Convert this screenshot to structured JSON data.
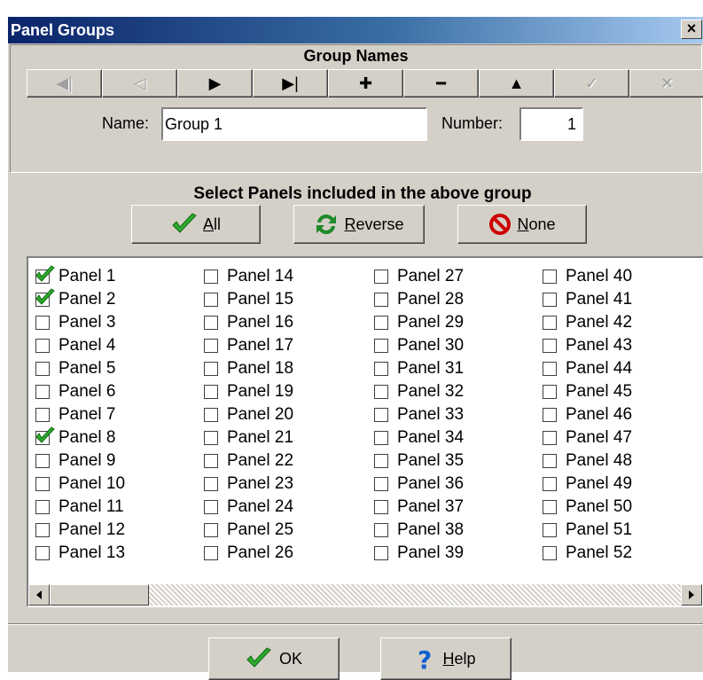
{
  "window": {
    "title": "Panel Groups",
    "close_label": "×"
  },
  "group_names": {
    "heading": "Group Names",
    "nav_buttons": [
      {
        "name": "first-record",
        "glyph": "◀|",
        "enabled": false
      },
      {
        "name": "prior-record",
        "glyph": "◁",
        "enabled": false
      },
      {
        "name": "next-record",
        "glyph": "▶",
        "enabled": true
      },
      {
        "name": "last-record",
        "glyph": "▶|",
        "enabled": true
      },
      {
        "name": "insert-record",
        "glyph": "✚",
        "enabled": true
      },
      {
        "name": "delete-record",
        "glyph": "━",
        "enabled": true
      },
      {
        "name": "edit-record",
        "glyph": "▲",
        "enabled": true
      },
      {
        "name": "post-edit",
        "glyph": "✓",
        "enabled": false
      },
      {
        "name": "cancel-edit",
        "glyph": "✕",
        "enabled": false
      }
    ]
  },
  "fields": {
    "name_label": "Name:",
    "name_value": "Group 1",
    "number_label": "Number:",
    "number_value": "1"
  },
  "selection": {
    "heading": "Select Panels included in the above group",
    "all_prefix": "",
    "all_key": "A",
    "all_rest": "ll",
    "reverse_key": "R",
    "reverse_rest": "everse",
    "none_key": "N",
    "none_rest": "one"
  },
  "panels": {
    "columns": [
      [
        "Panel 1",
        "Panel 2",
        "Panel 3",
        "Panel 4",
        "Panel 5",
        "Panel 6",
        "Panel 7",
        "Panel 8",
        "Panel 9",
        "Panel 10",
        "Panel 11",
        "Panel 12",
        "Panel 13"
      ],
      [
        "Panel 14",
        "Panel 15",
        "Panel 16",
        "Panel 17",
        "Panel 18",
        "Panel 19",
        "Panel 20",
        "Panel 21",
        "Panel 22",
        "Panel 23",
        "Panel 24",
        "Panel 25",
        "Panel 26"
      ],
      [
        "Panel 27",
        "Panel 28",
        "Panel 29",
        "Panel 30",
        "Panel 31",
        "Panel 32",
        "Panel 33",
        "Panel 34",
        "Panel 35",
        "Panel 36",
        "Panel 37",
        "Panel 38",
        "Panel 39"
      ],
      [
        "Panel 40",
        "Panel 41",
        "Panel 42",
        "Panel 43",
        "Panel 44",
        "Panel 45",
        "Panel 46",
        "Panel 47",
        "Panel 48",
        "Panel 49",
        "Panel 50",
        "Panel 51",
        "Panel 52"
      ]
    ],
    "checked": [
      "Panel 1",
      "Panel 2",
      "Panel 8"
    ]
  },
  "footer": {
    "ok_label": "OK",
    "help_key": "H",
    "help_rest": "elp"
  },
  "colors": {
    "check_green": "#2eaa2e",
    "reverse_green": "#1e8a2a",
    "none_red": "#cc0000",
    "help_blue": "#1060d0"
  }
}
